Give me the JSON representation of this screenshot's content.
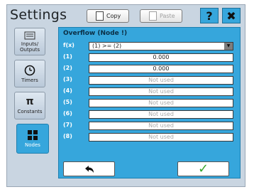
{
  "header": {
    "title": "Settings",
    "copy_label": "Copy",
    "paste_label": "Paste",
    "help_label": "?",
    "close_label": "✖"
  },
  "sidebar": {
    "tabs": [
      {
        "label": "Inputs/ Outputs",
        "icon": "input-output-icon"
      },
      {
        "label": "Timers",
        "icon": "clock-icon"
      },
      {
        "label": "Constants",
        "icon": "pi-icon"
      },
      {
        "label": "Nodes",
        "icon": "nodes-grid-icon",
        "active": true
      }
    ]
  },
  "panel": {
    "title": "Overflow (Node !)",
    "function": {
      "label": "f(x)",
      "value": "(1) >= (2)"
    },
    "params": [
      {
        "label": "(1)",
        "value": "0.000",
        "used": true
      },
      {
        "label": "(2)",
        "value": "0.000",
        "used": true
      },
      {
        "label": "(3)",
        "value": "Not used",
        "used": false
      },
      {
        "label": "(4)",
        "value": "Not used",
        "used": false
      },
      {
        "label": "(5)",
        "value": "Not used",
        "used": false
      },
      {
        "label": "(6)",
        "value": "Not used",
        "used": false
      },
      {
        "label": "(7)",
        "value": "Not used",
        "used": false
      },
      {
        "label": "(8)",
        "value": "Not used",
        "used": false
      }
    ]
  },
  "footer": {
    "back_icon": "back-arrow-icon",
    "ok_icon": "checkmark-icon"
  },
  "colors": {
    "accent": "#36a6dc",
    "background": "#c9d5e1",
    "ok": "#39a62c"
  }
}
